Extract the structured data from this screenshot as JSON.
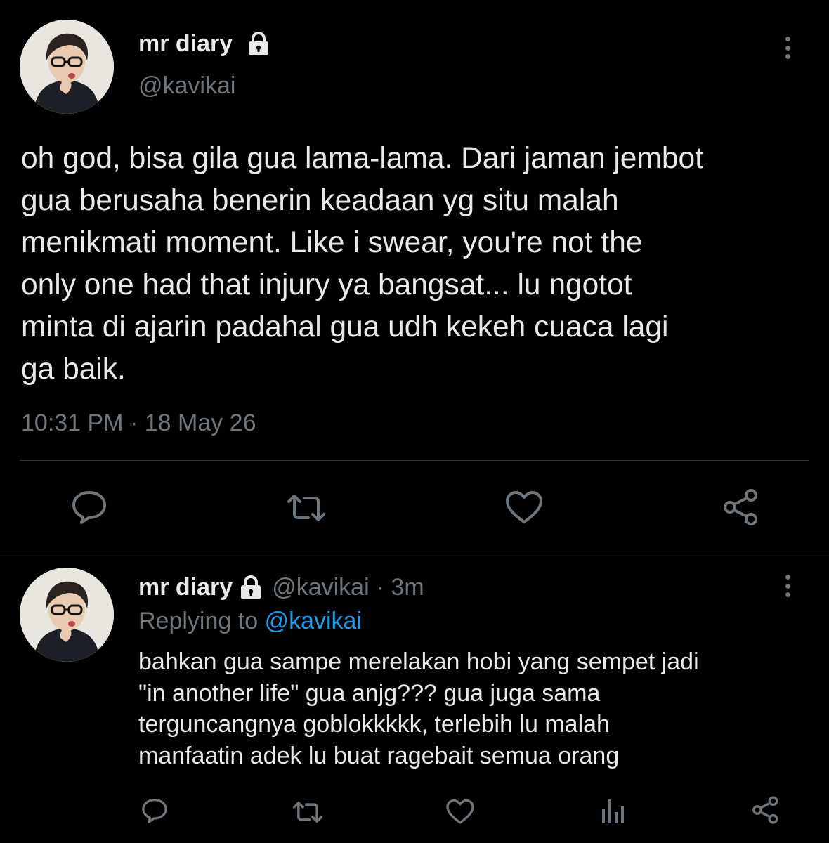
{
  "main_tweet": {
    "author_name": "mr diary",
    "handle": "@kavikai",
    "text_lines": [
      "oh god, bisa gila gua lama-lama. Dari jaman jembot",
      "gua berusaha benerin keadaan yg situ malah",
      "menikmati moment. Like i swear, you're not the",
      "only one had that injury ya bangsat... lu ngotot",
      "minta di ajarin padahal gua udh kekeh cuaca lagi",
      "ga baik."
    ],
    "timestamp": "10:31 PM · 18 May 26",
    "actions": [
      "reply-icon",
      "retweet-icon",
      "like-icon",
      "share-icon"
    ]
  },
  "reply_tweet": {
    "author_name": "mr diary",
    "handle": "@kavikai",
    "time_ago": "· 3m",
    "replying_prefix": "Replying to",
    "replying_handle": "@kavikai",
    "text_lines": [
      "bahkan gua sampe merelakan hobi yang sempet jadi",
      "\"in another life\" gua anjg??? gua juga sama",
      "terguncangnya goblokkkkk, terlebih lu malah",
      "manfaatin adek lu buat ragebait semua orang"
    ],
    "actions": [
      "reply-icon",
      "retweet-icon",
      "like-icon",
      "analytics-icon",
      "share-icon"
    ]
  },
  "colors": {
    "background": "#000000",
    "text": "#d9d9d9",
    "muted": "#6e767d",
    "link": "#1d9bf0",
    "divider": "#2f3336"
  }
}
